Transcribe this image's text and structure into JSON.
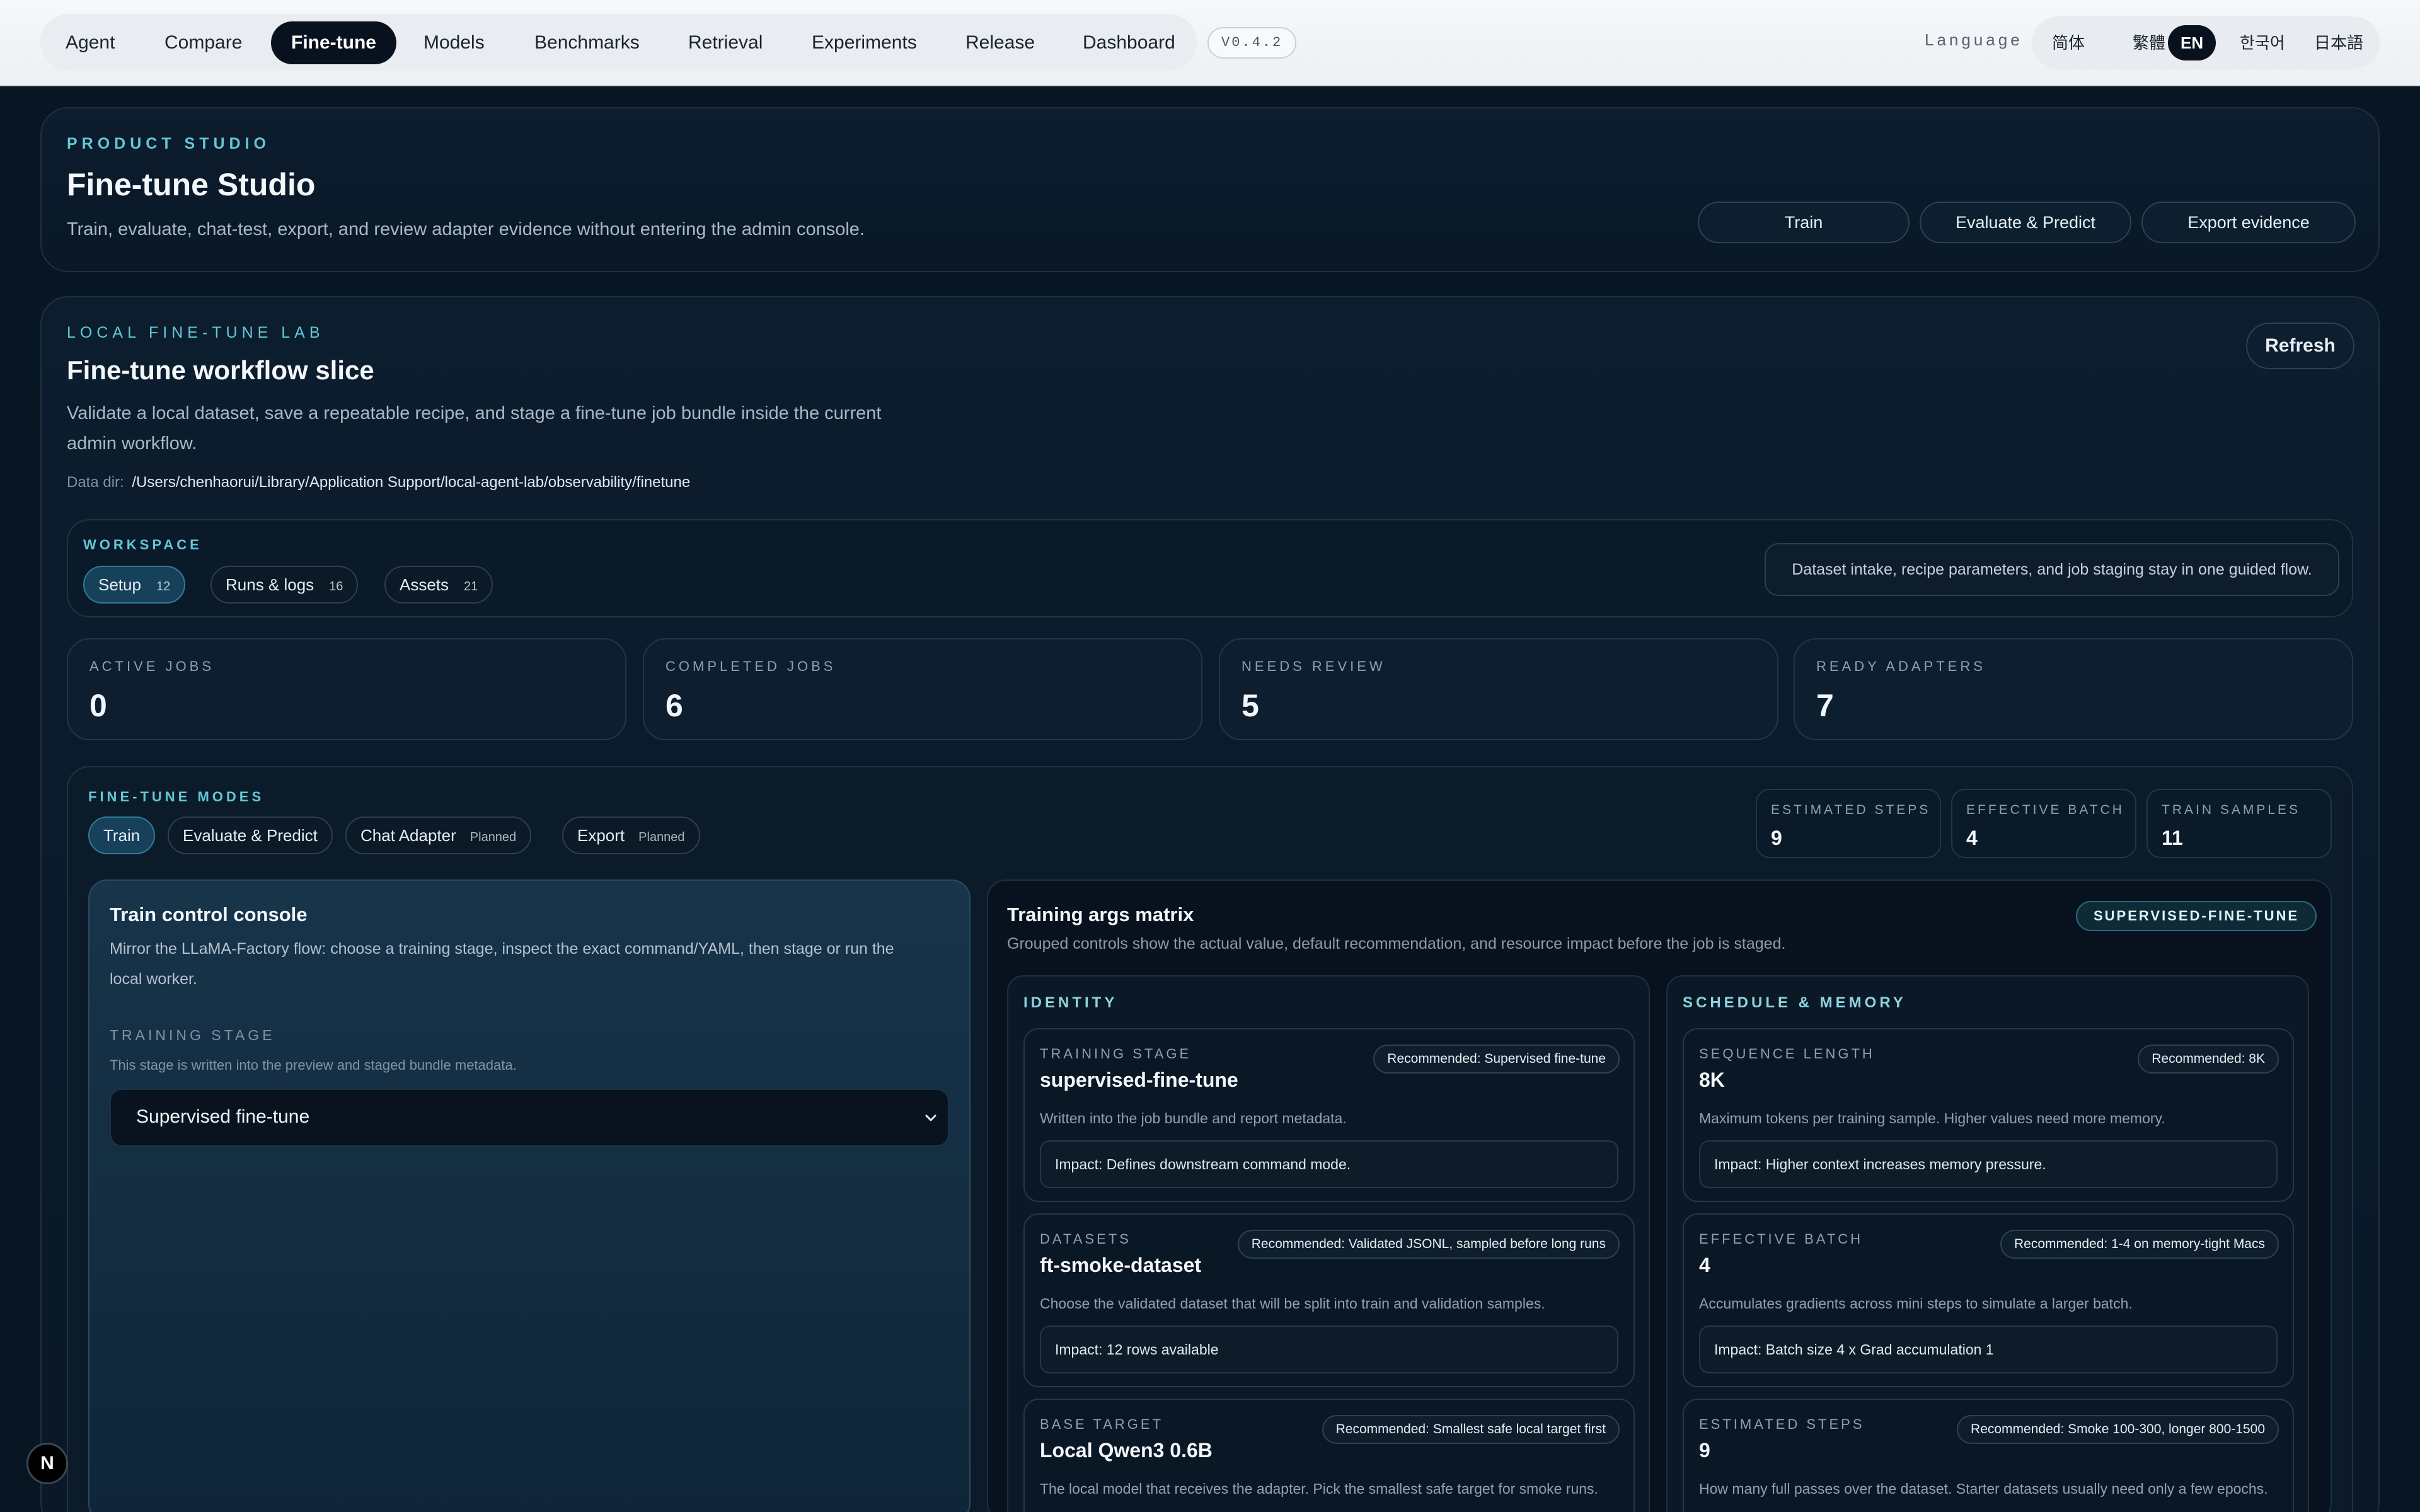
{
  "nav": {
    "items": [
      "Agent",
      "Compare",
      "Fine-tune",
      "Models",
      "Benchmarks",
      "Retrieval",
      "Experiments",
      "Release",
      "Dashboard"
    ],
    "active": "Fine-tune",
    "version": "V0.4.2"
  },
  "language": {
    "label": "Language",
    "options": [
      "简体",
      "繁體",
      "EN",
      "한국어",
      "日本語"
    ],
    "active": "EN"
  },
  "studio": {
    "eyebrow": "PRODUCT STUDIO",
    "title": "Fine-tune Studio",
    "subtitle": "Train, evaluate, chat-test, export, and review adapter evidence without entering the admin console.",
    "buttons": [
      "Train",
      "Evaluate & Predict",
      "Export evidence"
    ]
  },
  "lab": {
    "eyebrow": "LOCAL FINE-TUNE LAB",
    "title": "Fine-tune workflow slice",
    "description_line1": "Validate a local dataset, save a repeatable recipe, and stage a fine-tune job bundle inside the current",
    "description_line2": "admin workflow.",
    "data_dir_label": "Data dir:",
    "data_dir": "/Users/chenhaorui/Library/Application Support/local-agent-lab/observability/finetune",
    "refresh_label": "Refresh"
  },
  "workspace": {
    "eyebrow": "WORKSPACE",
    "tabs": [
      {
        "label": "Setup",
        "count": "12"
      },
      {
        "label": "Runs & logs",
        "count": "16"
      },
      {
        "label": "Assets",
        "count": "21"
      }
    ],
    "active": "Setup",
    "hint": "Dataset intake, recipe parameters, and job staging stay in one guided flow."
  },
  "stats": [
    {
      "label": "ACTIVE JOBS",
      "value": "0"
    },
    {
      "label": "COMPLETED JOBS",
      "value": "6"
    },
    {
      "label": "NEEDS REVIEW",
      "value": "5"
    },
    {
      "label": "READY ADAPTERS",
      "value": "7"
    }
  ],
  "modes": {
    "eyebrow": "FINE-TUNE MODES",
    "tabs": [
      {
        "label": "Train",
        "badge": ""
      },
      {
        "label": "Evaluate & Predict",
        "badge": ""
      },
      {
        "label": "Chat Adapter",
        "badge": "Planned"
      },
      {
        "label": "Export",
        "badge": "Planned"
      }
    ],
    "active": "Train",
    "metrics": [
      {
        "label": "ESTIMATED STEPS",
        "value": "9"
      },
      {
        "label": "EFFECTIVE BATCH",
        "value": "4"
      },
      {
        "label": "TRAIN SAMPLES",
        "value": "11"
      }
    ]
  },
  "console": {
    "title": "Train control console",
    "description_line1": "Mirror the LLaMA-Factory flow: choose a training stage, inspect the exact command/YAML, then stage or run the",
    "description_line2": "local worker.",
    "stage_label": "TRAINING STAGE",
    "stage_hint": "This stage is written into the preview and staged bundle metadata.",
    "stage_value": "Supervised fine-tune"
  },
  "matrix": {
    "title": "Training args matrix",
    "subtitle": "Grouped controls show the actual value, default recommendation, and resource impact before the job is staged.",
    "badge": "SUPERVISED-FINE-TUNE",
    "groups": [
      {
        "title": "IDENTITY",
        "cards": [
          {
            "label": "TRAINING STAGE",
            "value": "supervised-fine-tune",
            "rec": "Recommended: Supervised fine-tune",
            "desc": "Written into the job bundle and report metadata.",
            "impact": "Impact: Defines downstream command mode."
          },
          {
            "label": "DATASETS",
            "value": "ft-smoke-dataset",
            "rec": "Recommended: Validated JSONL, sampled before long runs",
            "desc": "Choose the validated dataset that will be split into train and validation samples.",
            "impact": "Impact: 12 rows available"
          },
          {
            "label": "BASE TARGET",
            "value": "Local Qwen3 0.6B",
            "rec": "Recommended: Smallest safe local target first",
            "desc": "The local model that receives the adapter. Pick the smallest safe target for smoke runs.",
            "impact": ""
          }
        ]
      },
      {
        "title": "SCHEDULE & MEMORY",
        "cards": [
          {
            "label": "SEQUENCE LENGTH",
            "value": "8K",
            "rec": "Recommended: 8K",
            "desc": "Maximum tokens per training sample. Higher values need more memory.",
            "impact": "Impact: Higher context increases memory pressure."
          },
          {
            "label": "EFFECTIVE BATCH",
            "value": "4",
            "rec": "Recommended: 1-4 on memory-tight Macs",
            "desc": "Accumulates gradients across mini steps to simulate a larger batch.",
            "impact": "Impact: Batch size 4 x Grad accumulation 1"
          },
          {
            "label": "ESTIMATED STEPS",
            "value": "9",
            "rec": "Recommended: Smoke 100-300, longer 800-1500",
            "desc": "How many full passes over the dataset. Starter datasets usually need only a few epochs.",
            "impact": ""
          }
        ]
      }
    ]
  },
  "fab": {
    "label": "N"
  }
}
